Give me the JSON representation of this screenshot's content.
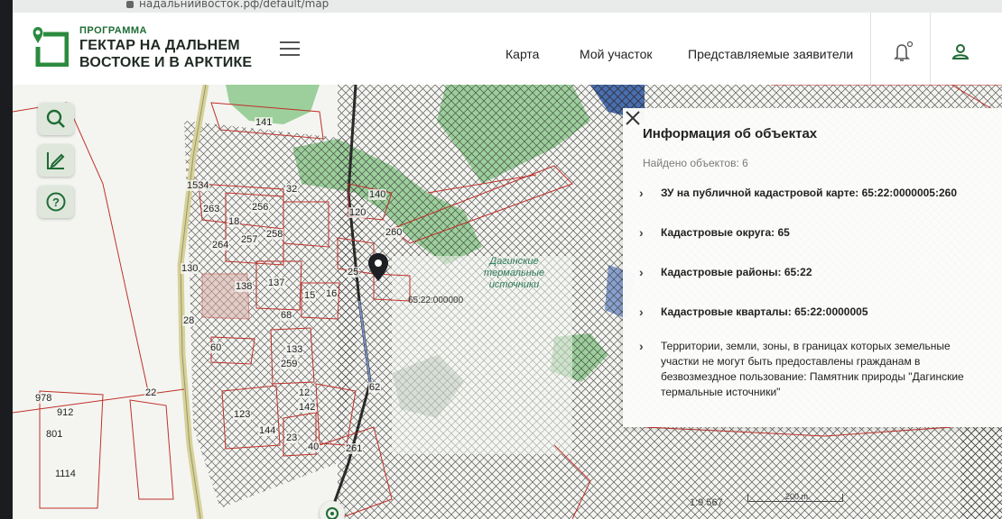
{
  "browser": {
    "url": "надальнийвосток.рф/default/map"
  },
  "header": {
    "logo": {
      "small": "ПРОГРАММА",
      "line1": "ГЕКТАР НА ДАЛЬНЕМ",
      "line2": "ВОСТОКЕ И В АРКТИКЕ"
    },
    "nav": [
      "Карта",
      "Мой участок",
      "Представляемые заявители"
    ],
    "icons": [
      "bell-icon",
      "user-icon"
    ]
  },
  "toolbar": {
    "tools": [
      "search-icon",
      "draw-edit-icon",
      "help-icon"
    ]
  },
  "panel": {
    "title": "Информация об объектах",
    "found": "Найдено объектов: 6",
    "items": [
      "ЗУ на публичной кадастровой карте: 65:22:0000005:260",
      "Кадастровые округа: 65",
      "Кадастровые районы: 65:22",
      "Кадастровые кварталы: 65:22:0000005",
      "Территории, земли, зоны, в границах которых земельные участки не могут быть предоставлены гражданам в безвозмездное пользование: Памятник природы \"Дагинские термальные источники\""
    ]
  },
  "map": {
    "parcel_labels": [
      "141",
      "32",
      "140",
      "1534",
      "263",
      "256",
      "18",
      "258",
      "120",
      "264",
      "257",
      "260",
      "130",
      "138",
      "137",
      "25",
      "15",
      "16",
      "68",
      "28",
      "60",
      "133",
      "259",
      "62",
      "12",
      "142",
      "123",
      "144",
      "23",
      "40",
      "261",
      "978",
      "912",
      "22",
      "801",
      "1114"
    ],
    "cadastral_number": "65:22:000000",
    "place_label": [
      "Дагинские",
      "термальные",
      "источники"
    ],
    "scale": "1:9 567",
    "scale_bar": "200 m",
    "colors": {
      "forest": "#9ccf9b",
      "hatch": "#3a3a3a",
      "parcel_line": "#c0302a",
      "road": "#d9d19a"
    }
  }
}
